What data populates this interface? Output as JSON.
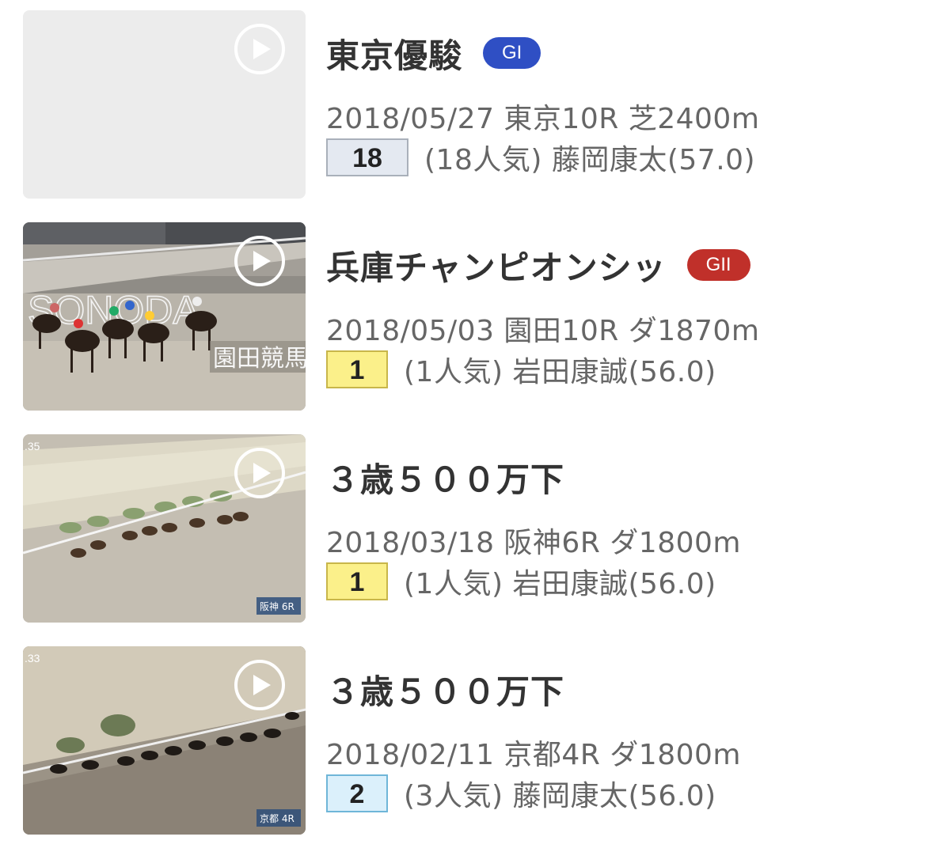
{
  "races": [
    {
      "name": "東京優駿",
      "grade": "GI",
      "grade_color": "#2f4fc4",
      "meta": "2018/05/27 東京10R 芝2400m",
      "rank": "18",
      "rank_bg": "#e4e9f1",
      "rank_border": "#a9b0ba",
      "result": "(18人気) 藤岡康太(57.0)",
      "thumb_overlay": ""
    },
    {
      "name": "兵庫チャンピオンシッ",
      "grade": "GII",
      "grade_color": "#c0302a",
      "meta": "2018/05/03 園田10R ダ1870m",
      "rank": "1",
      "rank_bg": "#fbf08a",
      "rank_border": "#c8b64a",
      "result": "(1人気) 岩田康誠(56.0)",
      "thumb_overlay": "SONODA",
      "thumb_caption": "園田競馬"
    },
    {
      "name": "３歳５００万下",
      "grade": "",
      "meta": "2018/03/18 阪神6R ダ1800m",
      "rank": "1",
      "rank_bg": "#fbf08a",
      "rank_border": "#c8b64a",
      "result": "(1人気) 岩田康誠(56.0)",
      "thumb_caption": "阪神 6R"
    },
    {
      "name": "３歳５００万下",
      "grade": "",
      "meta": "2018/02/11 京都4R ダ1800m",
      "rank": "2",
      "rank_bg": "#dbf0fb",
      "rank_border": "#6fb6d8",
      "result": "(3人気) 藤岡康太(56.0)",
      "thumb_caption": "京都 4R"
    }
  ],
  "icons": {
    "play": "play-icon"
  }
}
